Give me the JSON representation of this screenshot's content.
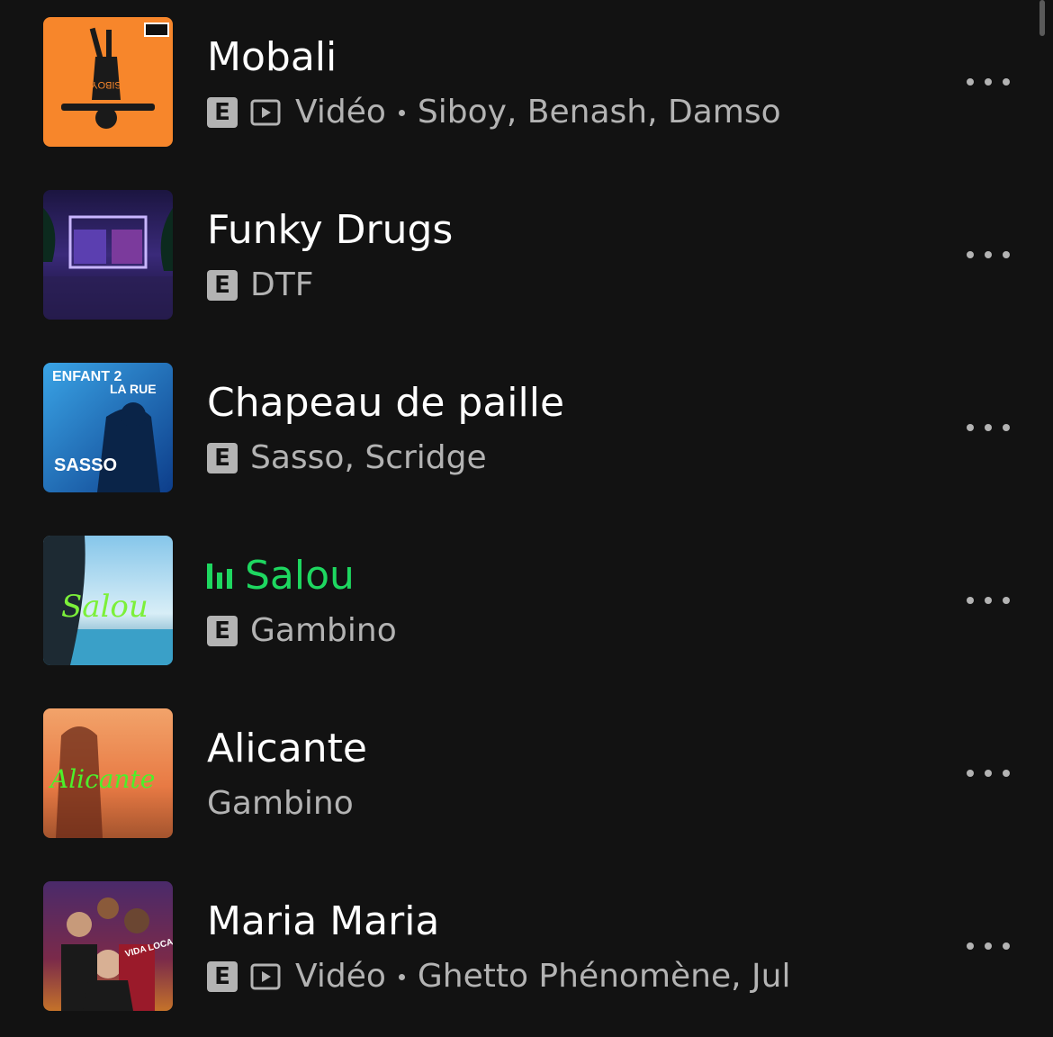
{
  "tracks": [
    {
      "title": "Mobali",
      "explicit": "E",
      "has_video": true,
      "video_label": "Vidéo",
      "artists": "Siboy, Benash, Damso",
      "playing": false
    },
    {
      "title": "Funky Drugs",
      "explicit": "E",
      "has_video": false,
      "video_label": "",
      "artists": "DTF",
      "playing": false
    },
    {
      "title": "Chapeau de paille",
      "explicit": "E",
      "has_video": false,
      "video_label": "",
      "artists": "Sasso, Scridge",
      "playing": false
    },
    {
      "title": "Salou",
      "explicit": "E",
      "has_video": false,
      "video_label": "",
      "artists": "Gambino",
      "playing": true
    },
    {
      "title": "Alicante",
      "explicit": "",
      "has_video": false,
      "video_label": "",
      "artists": "Gambino",
      "playing": false
    },
    {
      "title": "Maria Maria",
      "explicit": "E",
      "has_video": true,
      "video_label": "Vidéo",
      "artists": "Ghetto Phénomène, Jul",
      "playing": false
    }
  ],
  "cover_texts": {
    "siboy": "SIBOY",
    "sasso_top": "ENFANT 2",
    "sasso_rue": "LA RUE",
    "sasso_name": "SASSO",
    "salou_script": "Salou",
    "alicante_script": "Alicante",
    "maria_loca": "VIDA LOCA"
  },
  "colors": {
    "background": "#121212",
    "text_primary": "#ffffff",
    "text_secondary": "#b3b3b3",
    "accent_playing": "#1ed760"
  },
  "icons": {
    "explicit": "explicit-badge-icon",
    "video": "video-play-icon",
    "more": "more-options-icon",
    "now_playing": "equalizer-icon"
  }
}
